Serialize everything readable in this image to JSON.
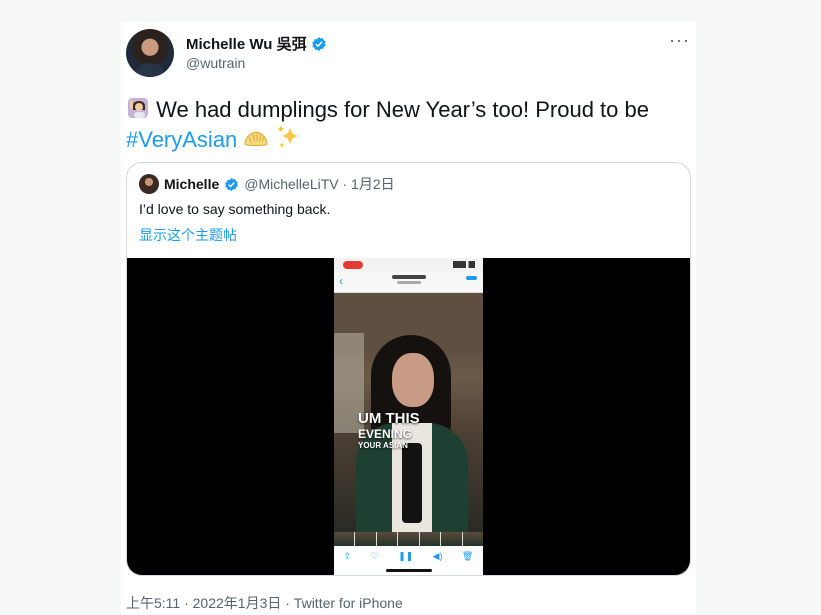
{
  "tweet": {
    "author_name": "Michelle Wu 吳弭",
    "author_handle": "@wutrain",
    "more_label": "···",
    "text_before_hashtag": " We had dumplings for New Year’s too! Proud to be ",
    "hashtag": "#VeryAsian",
    "emoji_icons": [
      "woman-gesturing-icon",
      "dumpling-icon",
      "sparkles-icon"
    ],
    "timestamp": "上午5:11 · 2022年1月3日 · Twitter for iPhone"
  },
  "quoted_tweet": {
    "author_name": "Michelle",
    "meta": "@MichelleLiTV · 1月2日",
    "text": "I’d love to say something back.",
    "show_thread": "显示这个主题帖"
  },
  "video": {
    "caption_line1": "UM THIS",
    "caption_line2": "EVENING",
    "caption_line3": "YOUR ASIAN"
  },
  "colors": {
    "accent": "#1d9bf0",
    "text": "#0f1419",
    "muted": "#536471",
    "border": "#cfd9de"
  }
}
